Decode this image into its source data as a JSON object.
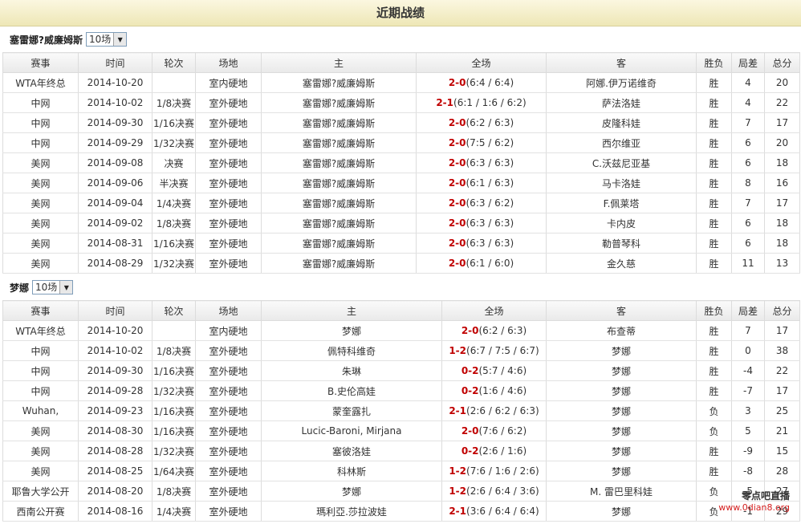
{
  "banner": {
    "title": "近期战绩"
  },
  "sections": [
    {
      "player": "塞雷娜?威廉姆斯",
      "selected": "10场",
      "headers": [
        "赛事",
        "时间",
        "轮次",
        "场地",
        "主",
        "全场",
        "客",
        "胜负",
        "局差",
        "总分"
      ],
      "rows": [
        {
          "event": "WTA年终总",
          "date": "2014-10-20",
          "round": "",
          "surface": "室内硬地",
          "home": "塞雷娜?威廉姆斯",
          "score_main": "2-0",
          "score_detail": "(6:4 / 6:4)",
          "away": "阿娜.伊万诺维奇",
          "result": "胜",
          "diff": "4",
          "total": "20",
          "home_color": "red",
          "away_color": "normal"
        },
        {
          "event": "中网",
          "date": "2014-10-02",
          "round": "1/8决赛",
          "surface": "室外硬地",
          "home": "塞雷娜?威廉姆斯",
          "score_main": "2-1",
          "score_detail": "(6:1 / 1:6 / 6:2)",
          "away": "萨法洛娃",
          "result": "胜",
          "diff": "4",
          "total": "22",
          "home_color": "red",
          "away_color": "normal"
        },
        {
          "event": "中网",
          "date": "2014-09-30",
          "round": "1/16决赛",
          "surface": "室外硬地",
          "home": "塞雷娜?威廉姆斯",
          "score_main": "2-0",
          "score_detail": "(6:2 / 6:3)",
          "away": "皮隆科娃",
          "result": "胜",
          "diff": "7",
          "total": "17",
          "home_color": "red",
          "away_color": "normal"
        },
        {
          "event": "中网",
          "date": "2014-09-29",
          "round": "1/32决赛",
          "surface": "室外硬地",
          "home": "塞雷娜?威廉姆斯",
          "score_main": "2-0",
          "score_detail": "(7:5 / 6:2)",
          "away": "西尔维亚",
          "result": "胜",
          "diff": "6",
          "total": "20",
          "home_color": "red",
          "away_color": "normal"
        },
        {
          "event": "美网",
          "date": "2014-09-08",
          "round": "决赛",
          "surface": "室外硬地",
          "home": "塞雷娜?威廉姆斯",
          "score_main": "2-0",
          "score_detail": "(6:3 / 6:3)",
          "away": "C.沃兹尼亚基",
          "result": "胜",
          "diff": "6",
          "total": "18",
          "home_color": "red",
          "away_color": "normal"
        },
        {
          "event": "美网",
          "date": "2014-09-06",
          "round": "半决赛",
          "surface": "室外硬地",
          "home": "塞雷娜?威廉姆斯",
          "score_main": "2-0",
          "score_detail": "(6:1 / 6:3)",
          "away": "马卡洛娃",
          "result": "胜",
          "diff": "8",
          "total": "16",
          "home_color": "red",
          "away_color": "normal"
        },
        {
          "event": "美网",
          "date": "2014-09-04",
          "round": "1/4决赛",
          "surface": "室外硬地",
          "home": "塞雷娜?威廉姆斯",
          "score_main": "2-0",
          "score_detail": "(6:3 / 6:2)",
          "away": "F.佩莱塔",
          "result": "胜",
          "diff": "7",
          "total": "17",
          "home_color": "red",
          "away_color": "normal"
        },
        {
          "event": "美网",
          "date": "2014-09-02",
          "round": "1/8决赛",
          "surface": "室外硬地",
          "home": "塞雷娜?威廉姆斯",
          "score_main": "2-0",
          "score_detail": "(6:3 / 6:3)",
          "away": "卡内皮",
          "result": "胜",
          "diff": "6",
          "total": "18",
          "home_color": "red",
          "away_color": "normal"
        },
        {
          "event": "美网",
          "date": "2014-08-31",
          "round": "1/16决赛",
          "surface": "室外硬地",
          "home": "塞雷娜?威廉姆斯",
          "score_main": "2-0",
          "score_detail": "(6:3 / 6:3)",
          "away": "勒普琴科",
          "result": "胜",
          "diff": "6",
          "total": "18",
          "home_color": "red",
          "away_color": "normal"
        },
        {
          "event": "美网",
          "date": "2014-08-29",
          "round": "1/32决赛",
          "surface": "室外硬地",
          "home": "塞雷娜?威廉姆斯",
          "score_main": "2-0",
          "score_detail": "(6:1 / 6:0)",
          "away": "金久慈",
          "result": "胜",
          "diff": "11",
          "total": "13",
          "home_color": "red",
          "away_color": "normal"
        }
      ]
    },
    {
      "player": "梦娜",
      "selected": "10场",
      "headers": [
        "赛事",
        "时间",
        "轮次",
        "场地",
        "主",
        "全场",
        "客",
        "胜负",
        "局差",
        "总分"
      ],
      "rows": [
        {
          "event": "WTA年终总",
          "date": "2014-10-20",
          "round": "",
          "surface": "室内硬地",
          "home": "梦娜",
          "score_main": "2-0",
          "score_detail": "(6:2 / 6:3)",
          "away": "布查蒂",
          "result": "胜",
          "diff": "7",
          "total": "17",
          "home_color": "red",
          "away_color": "normal"
        },
        {
          "event": "中网",
          "date": "2014-10-02",
          "round": "1/8决赛",
          "surface": "室外硬地",
          "home": "佩特科维奇",
          "score_main": "1-2",
          "score_detail": "(6:7 / 7:5 / 6:7)",
          "away": "梦娜",
          "result": "胜",
          "diff": "0",
          "total": "38",
          "home_color": "normal",
          "away_color": "red"
        },
        {
          "event": "中网",
          "date": "2014-09-30",
          "round": "1/16决赛",
          "surface": "室外硬地",
          "home": "朱琳",
          "score_main": "0-2",
          "score_detail": "(5:7 / 4:6)",
          "away": "梦娜",
          "result": "胜",
          "diff": "-4",
          "total": "22",
          "home_color": "normal",
          "away_color": "red"
        },
        {
          "event": "中网",
          "date": "2014-09-28",
          "round": "1/32决赛",
          "surface": "室外硬地",
          "home": "B.史伦高娃",
          "score_main": "0-2",
          "score_detail": "(1:6 / 4:6)",
          "away": "梦娜",
          "result": "胜",
          "diff": "-7",
          "total": "17",
          "home_color": "normal",
          "away_color": "red"
        },
        {
          "event": "Wuhan,",
          "date": "2014-09-23",
          "round": "1/16决赛",
          "surface": "室外硬地",
          "home": "蒙奎露扎",
          "score_main": "2-1",
          "score_detail": "(2:6 / 6:2 / 6:3)",
          "away": "梦娜",
          "result": "负",
          "diff": "3",
          "total": "25",
          "home_color": "normal",
          "away_color": "blue"
        },
        {
          "event": "美网",
          "date": "2014-08-30",
          "round": "1/16决赛",
          "surface": "室外硬地",
          "home": "Lucic-Baroni, Mirjana",
          "score_main": "2-0",
          "score_detail": "(7:6 / 6:2)",
          "away": "梦娜",
          "result": "负",
          "diff": "5",
          "total": "21",
          "home_color": "normal",
          "away_color": "blue"
        },
        {
          "event": "美网",
          "date": "2014-08-28",
          "round": "1/32决赛",
          "surface": "室外硬地",
          "home": "塞彼洛娃",
          "score_main": "0-2",
          "score_detail": "(2:6 / 1:6)",
          "away": "梦娜",
          "result": "胜",
          "diff": "-9",
          "total": "15",
          "home_color": "normal",
          "away_color": "red"
        },
        {
          "event": "美网",
          "date": "2014-08-25",
          "round": "1/64决赛",
          "surface": "室外硬地",
          "home": "科林斯",
          "score_main": "1-2",
          "score_detail": "(7:6 / 1:6 / 2:6)",
          "away": "梦娜",
          "result": "胜",
          "diff": "-8",
          "total": "28",
          "home_color": "normal",
          "away_color": "red"
        },
        {
          "event": "耶鲁大学公开",
          "date": "2014-08-20",
          "round": "1/8决赛",
          "surface": "室外硬地",
          "home": "梦娜",
          "score_main": "1-2",
          "score_detail": "(2:6 / 6:4 / 3:6)",
          "away": "M. 雷巴里科娃",
          "result": "负",
          "diff": "-5",
          "total": "27",
          "home_color": "blue",
          "away_color": "normal"
        },
        {
          "event": "西南公开赛",
          "date": "2014-08-16",
          "round": "1/4决赛",
          "surface": "室外硬地",
          "home": "瑪利亞.莎拉波娃",
          "score_main": "2-1",
          "score_detail": "(3:6 / 6:4 / 6:4)",
          "away": "梦娜",
          "result": "负",
          "diff": "-1",
          "total": "29",
          "home_color": "normal",
          "away_color": "blue"
        }
      ]
    }
  ],
  "watermark": {
    "line1": "零点吧直播",
    "line2": "www.0dian8.org"
  }
}
